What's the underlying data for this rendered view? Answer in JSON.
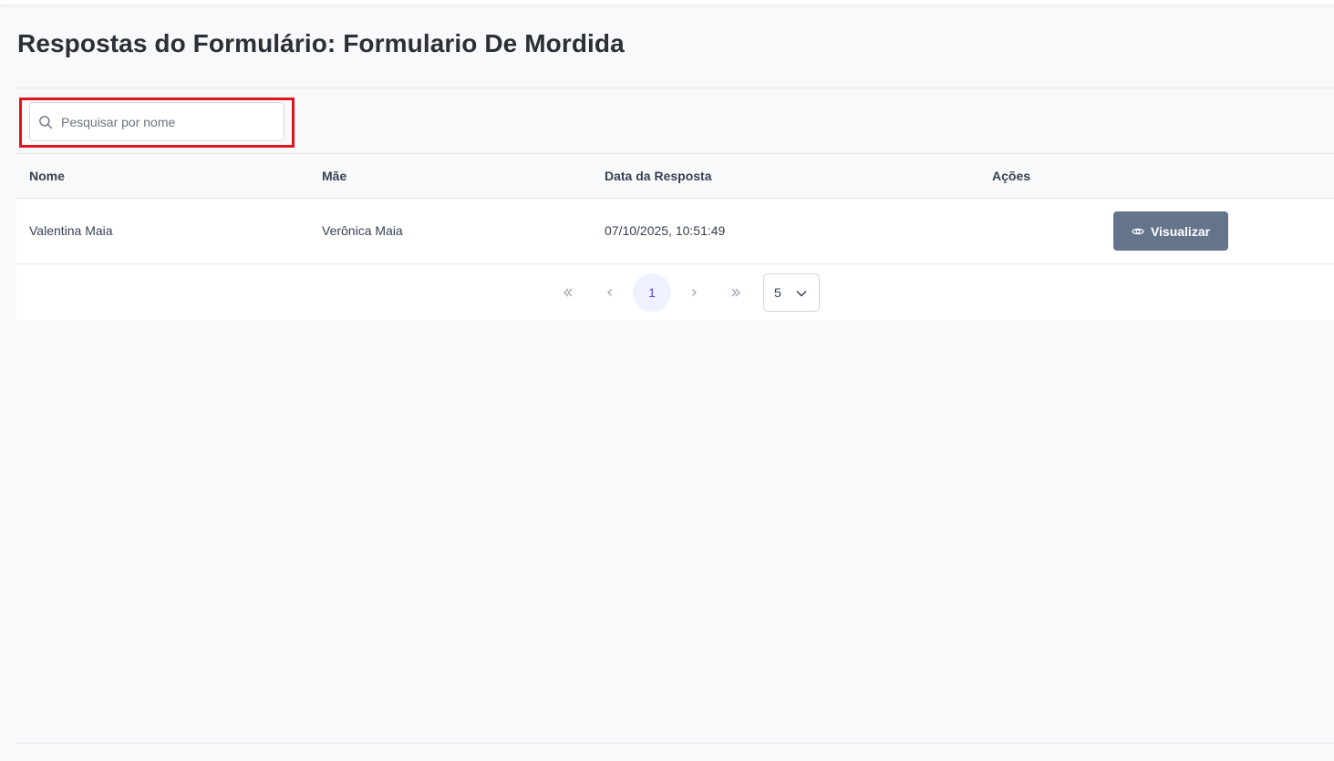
{
  "page": {
    "title": "Respostas do Formulário: Formulario De Mordida"
  },
  "search": {
    "placeholder": "Pesquisar por nome",
    "value": "",
    "icon": "search-icon"
  },
  "table": {
    "columns": [
      "Nome",
      "Mãe",
      "Data da Resposta",
      "Ações"
    ],
    "rows": [
      {
        "nome": "Valentina Maia",
        "mae": "Verônica Maia",
        "data": "07/10/2025, 10:51:49",
        "action_label": "Visualizar",
        "action_icon": "eye-icon"
      }
    ]
  },
  "pagination": {
    "first_icon": "double-chevron-left-icon",
    "prev_icon": "chevron-left-icon",
    "current_page": "1",
    "next_icon": "chevron-right-icon",
    "last_icon": "double-chevron-right-icon",
    "rows_per_page": "5"
  },
  "colors": {
    "accent": "#4f46e5",
    "button_bg": "#64748b",
    "highlight": "#e0141d",
    "background": "#f8f9fb"
  }
}
